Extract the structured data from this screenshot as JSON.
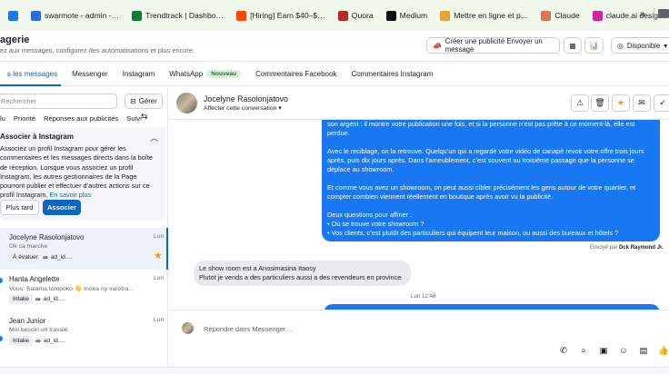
{
  "bookmarks": [
    {
      "label": "",
      "icon": "facebook-icon",
      "color": "#1877f2"
    },
    {
      "label": "swarmote - admin -…",
      "icon": "swarmote-icon",
      "color": "#2b6de0"
    },
    {
      "label": "Trendtrack | Dashbo…",
      "icon": "trendtrack-icon",
      "color": "#0c7b3a"
    },
    {
      "label": "[Hiring] Earn $40–$…",
      "icon": "reddit-icon",
      "color": "#ff4500"
    },
    {
      "label": "Quora",
      "icon": "quora-icon",
      "color": "#b92b27"
    },
    {
      "label": "Medium",
      "icon": "medium-icon",
      "color": "#111111"
    },
    {
      "label": "Mettre en ligne et p…",
      "icon": "gear-icon",
      "color": "#e8a13a"
    },
    {
      "label": "Claude",
      "icon": "claude-icon",
      "color": "#d97757"
    },
    {
      "label": "claude.ai design",
      "icon": "instagram-icon",
      "color": "#d6249f"
    }
  ],
  "bookmarks_more": "»",
  "header": {
    "title": "agerie",
    "subtitle": "ez aux messages, configurez des automatisations et plus encore.",
    "create_ad": "Créer une publicité Envoyer un message",
    "status": "Disponible"
  },
  "tabs": [
    {
      "label": "s les messages",
      "active": true
    },
    {
      "label": "Messenger"
    },
    {
      "label": "Instagram"
    },
    {
      "label": "WhatsApp",
      "badge": "Nouveau"
    },
    {
      "label": "Commentaires Facebook"
    },
    {
      "label": "Commentaires Instagram"
    }
  ],
  "left": {
    "search_placeholder": "Rechercher",
    "manage": "Gérer",
    "filters": [
      "lu",
      "Priorité",
      "Réponses aux publicités",
      "Suivi"
    ],
    "promo": {
      "title": "Associer à Instagram",
      "text": "Associez un profil Instagram pour gérer les commentaires et les messages directs dans la boîte de réception. Lorsque vous associez un profil Instagram, les autres gestionnaires de la Page pourront publier et effectuer d’autres actions sur ce profil Instagram.",
      "link": "En savoir plus",
      "later": "Plus tard",
      "associate": "Associer"
    },
    "conversations": [
      {
        "name": "Jocelyne Rasolonjatovo",
        "snippet": "Ok ca marche",
        "date": "Lun",
        "tag": "À évaluer",
        "ad": "ad_id.…",
        "starred": true,
        "selected": true
      },
      {
        "name": "Hanta Angelette",
        "snippet": "Vous: Salama tompoko 👋 Inona ny varotra…",
        "date": "Lun",
        "tag": "Intake",
        "ad": "ad_id.…"
      },
      {
        "name": "Jean Junior",
        "snippet": "Moi besoin un travaié",
        "date": "Lun",
        "tag": "Intake",
        "ad": "ad_id.…"
      }
    ]
  },
  "conversation": {
    "name": "Jocelyne Rasolonjatovo",
    "assign": "Affecter cette conversation",
    "out_paragraphs": [
      "son argent : il montre votre publication une fois, et si la personne n’est pas prête à ce moment-là, elle est perdue.",
      "Avec le reciblage, on la retrouve. Quelqu’un qui a regardé votre vidéo de canapé revoit votre offre trois jours après, puis dix jours après. Dans l’ameublement, c’est souvent au troisième passage que la personne se déplace au showroom.",
      "Et comme vous avez un showroom, on peut aussi cibler précisément les gens autour de votre quartier, et compter combien viennent réellement en boutique après avoir vu la publicité.",
      "Deux questions pour affiner :\n• Où se trouve votre showroom ?\n• Vos clients, c’est plutôt des particuliers qui équipent leur maison, ou aussi des bureaux et hôtels ?"
    ],
    "sent_by_label": "Envoyé par",
    "sent_by": "Dck Raymond Jr.",
    "in_lines": [
      "Le show room est a Anosimasina Itaosy",
      "Plutot je vends a des particuliers aussi a des revendeurs en province"
    ],
    "time": "Lun 12:48",
    "reply_placeholder": "Répondre dans Messenger…"
  }
}
